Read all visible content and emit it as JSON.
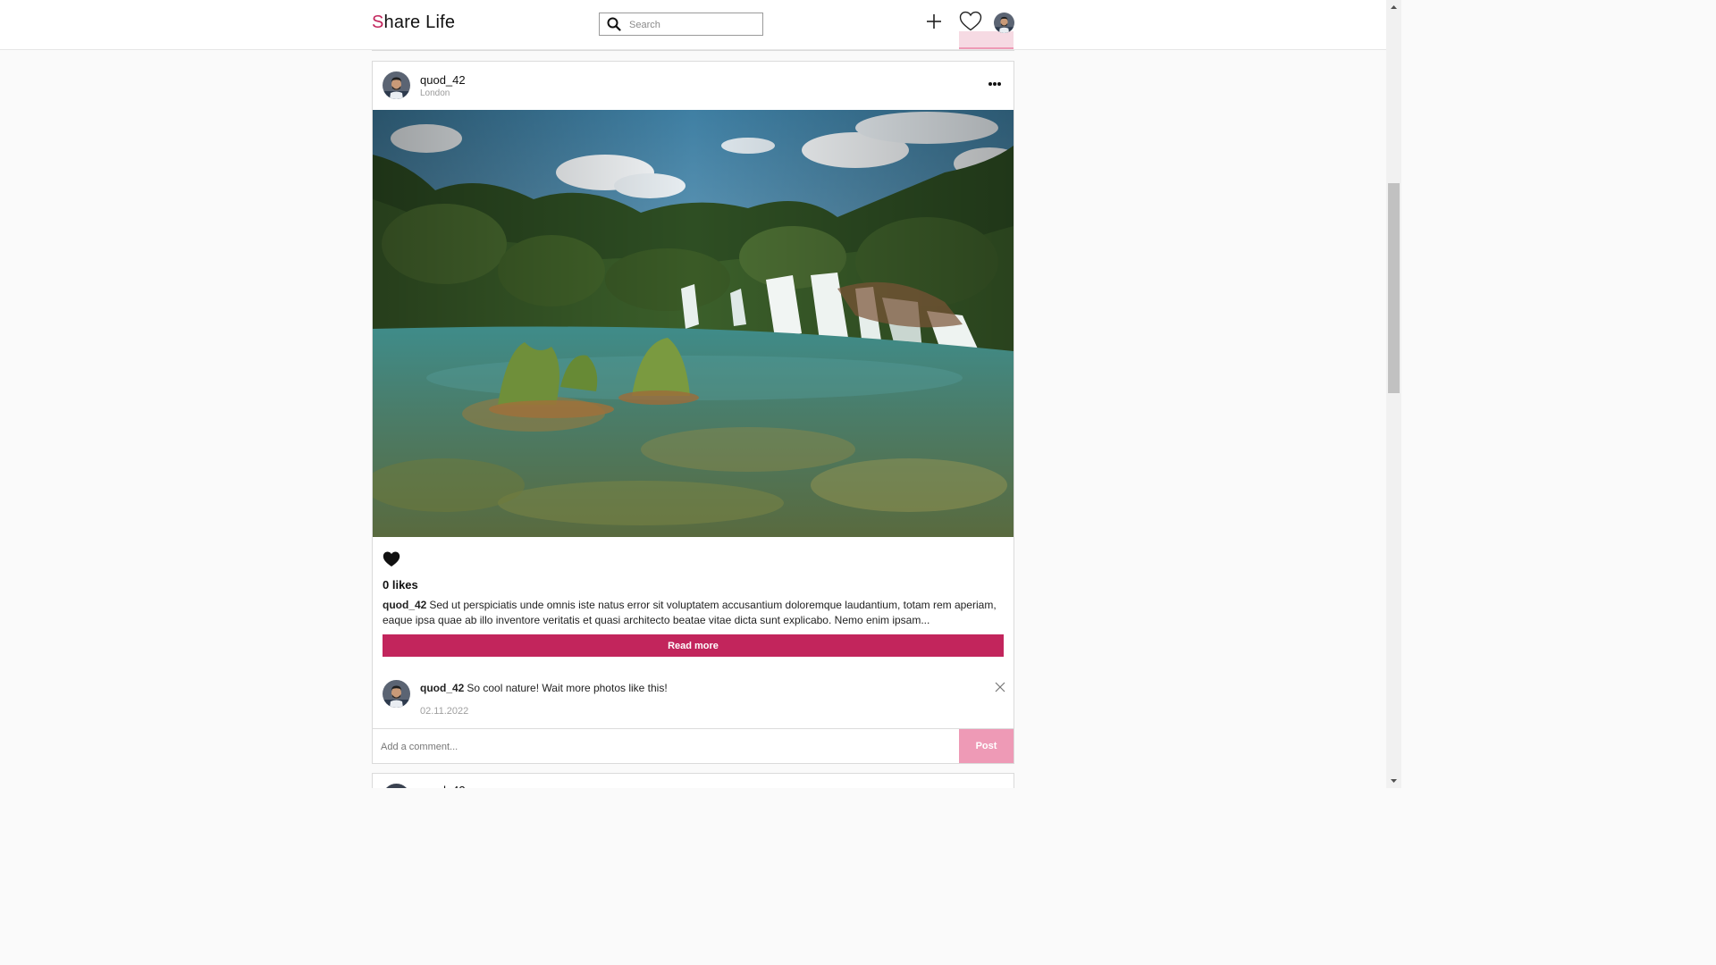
{
  "header": {
    "logo_first": "S",
    "logo_rest": "hare Life",
    "search_placeholder": "Search"
  },
  "post": {
    "username": "quod_42",
    "location": "London",
    "likes_text": "0 likes",
    "caption_user": "quod_42",
    "caption_text": "Sed ut perspiciatis unde omnis iste natus error sit voluptatem accusantium doloremque laudantium, totam rem aperiam, eaque ipsa quae ab illo inventore veritatis et quasi architecto beatae vitae dicta sunt explicabo. Nemo enim ipsam...",
    "read_more_label": "Read more",
    "comment": {
      "user": "quod_42",
      "text": "So cool nature! Wait more photos like this!",
      "date": "02.11.2022"
    },
    "add_comment_placeholder": "Add a comment...",
    "post_button_label": "Post"
  },
  "next_post": {
    "username": "quod_42"
  },
  "colors": {
    "accent": "#c2255c",
    "accent_light": "#ee9ab6"
  },
  "icons": [
    "search-icon",
    "plus-icon",
    "heart-outline-icon",
    "heart-filled-icon",
    "more-icon",
    "close-icon"
  ]
}
